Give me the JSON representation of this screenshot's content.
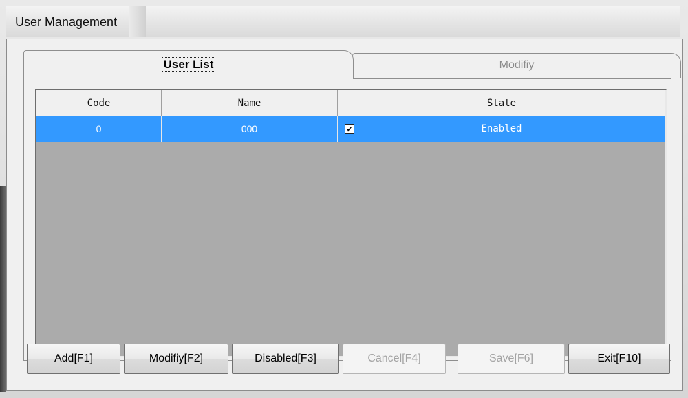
{
  "window": {
    "title": "User Management"
  },
  "tabs": [
    {
      "label": "User List",
      "active": true
    },
    {
      "label": "Modifiy",
      "active": false
    }
  ],
  "grid": {
    "columns": [
      "Code",
      "Name",
      "State"
    ],
    "rows": [
      {
        "code": "0",
        "name": "000",
        "enabled": true,
        "state": "Enabled",
        "selected": true
      }
    ]
  },
  "buttons": [
    {
      "label": "Add[F1]",
      "enabled": true
    },
    {
      "label": "Modifiy[F2]",
      "enabled": true
    },
    {
      "label": "Disabled[F3]",
      "enabled": true
    },
    {
      "label": "Cancel[F4]",
      "enabled": false
    },
    {
      "label": "Save[F6]",
      "enabled": false
    },
    {
      "label": "Exit[F10]",
      "enabled": true
    }
  ],
  "colors": {
    "selection": "#3399ff",
    "grid_background": "#ababab",
    "disabled_text": "#a3a3a3"
  },
  "icons": {
    "row_checkbox": "checkbox-checked-icon"
  }
}
